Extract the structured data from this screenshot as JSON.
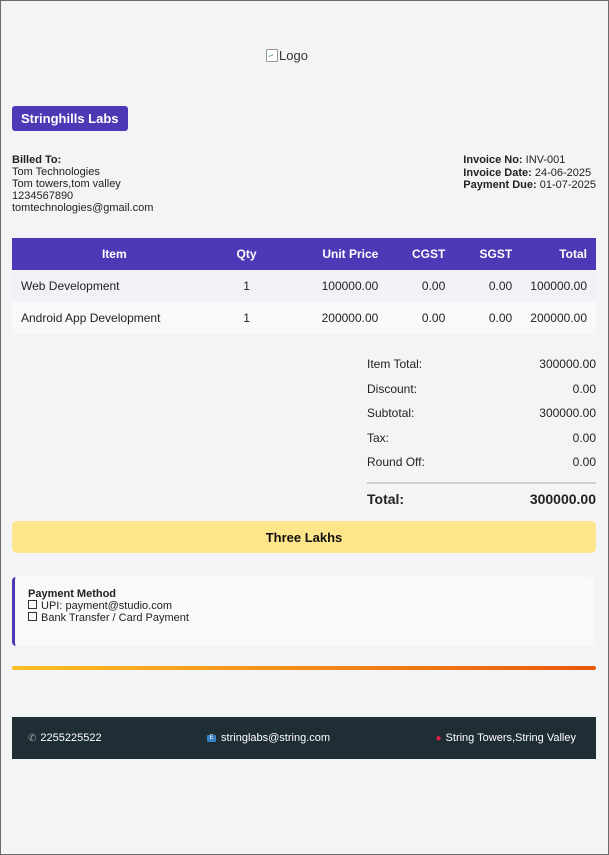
{
  "logo": {
    "alt": "Logo"
  },
  "brand": {
    "name": "Stringhills Labs"
  },
  "billed_to": {
    "label": "Billed To:",
    "name": "Tom Technologies",
    "address": "Tom towers,tom valley",
    "phone": "1234567890",
    "email": "tomtechnologies@gmail.com"
  },
  "invoice": {
    "no_label": "Invoice No:",
    "no": "INV-001",
    "date_label": "Invoice Date:",
    "date": "24-06-2025",
    "due_label": "Payment Due:",
    "due": "01-07-2025"
  },
  "table": {
    "headers": [
      "Item",
      "Qty",
      "Unit Price",
      "CGST",
      "SGST",
      "Total"
    ],
    "rows": [
      [
        "Web Development",
        "1",
        "100000.00",
        "0.00",
        "0.00",
        "100000.00"
      ],
      [
        "Android App Development",
        "1",
        "200000.00",
        "0.00",
        "0.00",
        "200000.00"
      ]
    ]
  },
  "summary": {
    "item_total_label": "Item Total:",
    "item_total": "300000.00",
    "discount_label": "Discount:",
    "discount": "0.00",
    "subtotal_label": "Subtotal:",
    "subtotal": "300000.00",
    "tax_label": "Tax:",
    "tax": "0.00",
    "round_off_label": "Round Off:",
    "round_off": "0.00",
    "total_label": "Total:",
    "total": "300000.00"
  },
  "amount_words": "Three Lakhs",
  "payment": {
    "title": "Payment Method",
    "options": [
      "UPI: payment@studio.com",
      "Bank Transfer / Card Payment"
    ]
  },
  "footer": {
    "phone": "2255225522",
    "email": "stringlabs@string.com",
    "address": "String Towers,String Valley"
  },
  "colors": {
    "brand": "#4f38b6",
    "highlight": "#fde68a",
    "footer_bg": "#1f2d35",
    "gradient_start": "#fbbf24",
    "gradient_end": "#ea580c"
  },
  "icons": [
    "broken-image-icon",
    "phone-icon",
    "email-icon",
    "location-pin-icon",
    "checkbox-icon"
  ]
}
